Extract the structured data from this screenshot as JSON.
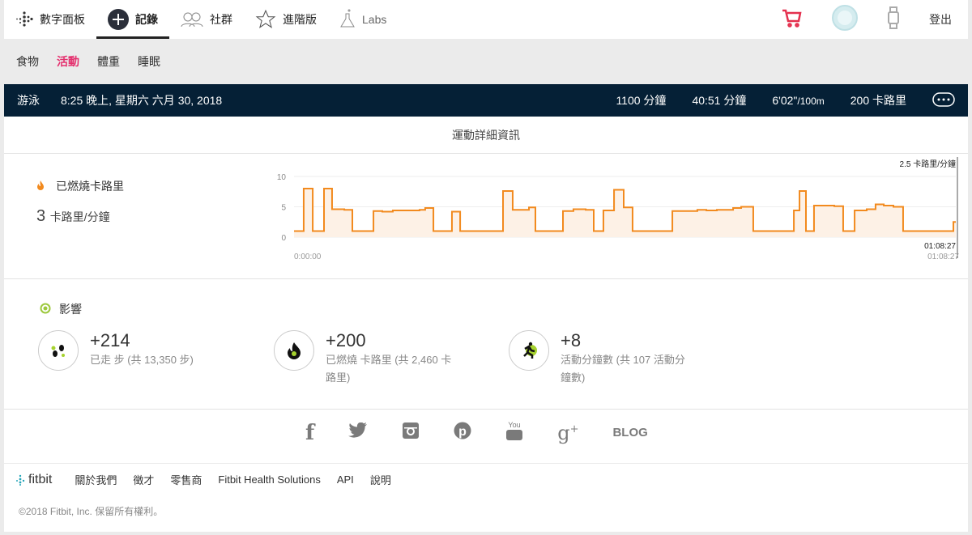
{
  "nav": {
    "items": [
      {
        "label": "數字面板",
        "icon": "fitbit-dots-icon"
      },
      {
        "label": "記錄",
        "icon": "plus-circle-icon",
        "active": true
      },
      {
        "label": "社群",
        "icon": "friends-icon"
      },
      {
        "label": "進階版",
        "icon": "star-icon"
      },
      {
        "label": "Labs",
        "icon": "flask-icon"
      }
    ],
    "logout": "登出"
  },
  "subnav": [
    "食物",
    "活動",
    "體重",
    "睡眠"
  ],
  "activity": {
    "type": "游泳",
    "datetime": "8:25 晚上, 星期六 六月 30, 2018",
    "stats": [
      "1100 分鐘",
      "40:51 分鐘"
    ],
    "pace": "6'02\"",
    "pace_unit": "/100m",
    "calories": "200 卡路里"
  },
  "detail": {
    "title": "運動詳細資訊",
    "cal_label": "已燃燒卡路里",
    "cal_value": "3",
    "cal_unit": "卡路里/分鐘"
  },
  "chart_data": {
    "type": "area",
    "ylabel": "卡路里/分鐘",
    "ylim": [
      0,
      10
    ],
    "yticks": [
      "0",
      "5",
      "10"
    ],
    "x_start_label": "0:00:00",
    "x_end_label": "01:08:27",
    "hover_value": "2.5 卡路里/分鐘",
    "hover_time": "01:08:27",
    "duration_s": 4107,
    "steps": [
      [
        0,
        1
      ],
      [
        60,
        8
      ],
      [
        116,
        1
      ],
      [
        186,
        8
      ],
      [
        236,
        4.6
      ],
      [
        312,
        4.5
      ],
      [
        362,
        1
      ],
      [
        493,
        4.3
      ],
      [
        548,
        4.2
      ],
      [
        613,
        4.4
      ],
      [
        779,
        4.5
      ],
      [
        814,
        4.8
      ],
      [
        865,
        1
      ],
      [
        980,
        4.2
      ],
      [
        1031,
        1
      ],
      [
        1297,
        7.6
      ],
      [
        1357,
        4.5
      ],
      [
        1458,
        4.9
      ],
      [
        1498,
        1
      ],
      [
        1669,
        4.3
      ],
      [
        1734,
        4.6
      ],
      [
        1810,
        4.5
      ],
      [
        1860,
        1
      ],
      [
        1920,
        4.4
      ],
      [
        1986,
        7.8
      ],
      [
        2046,
        4.9
      ],
      [
        2101,
        1
      ],
      [
        2348,
        4.3
      ],
      [
        2503,
        4.5
      ],
      [
        2559,
        4.4
      ],
      [
        2624,
        4.5
      ],
      [
        2725,
        4.8
      ],
      [
        2775,
        5.0
      ],
      [
        2850,
        1
      ],
      [
        3102,
        4.4
      ],
      [
        3137,
        7.6
      ],
      [
        3177,
        1
      ],
      [
        3227,
        5.2
      ],
      [
        3353,
        5.1
      ],
      [
        3408,
        1
      ],
      [
        3479,
        4.4
      ],
      [
        3554,
        4.6
      ],
      [
        3609,
        5.4
      ],
      [
        3660,
        5.2
      ],
      [
        3720,
        5.0
      ],
      [
        3780,
        1
      ],
      [
        4092,
        2.5
      ]
    ],
    "color": "#f28a1e"
  },
  "impact": {
    "title": "影響",
    "items": [
      {
        "value": "+214",
        "desc": "已走 步 (共 13,350 步)",
        "icon": "footsteps-icon"
      },
      {
        "value": "+200",
        "desc": "已燃燒 卡路里 (共 2,460 卡路里)",
        "icon": "flame-icon"
      },
      {
        "value": "+8",
        "desc": "活動分鐘數 (共 107 活動分鐘數)",
        "icon": "runner-icon"
      }
    ]
  },
  "social": {
    "blog": "BLOG"
  },
  "footer": {
    "brand": "fitbit",
    "links": [
      "關於我們",
      "徵才",
      "零售商",
      "Fitbit Health Solutions",
      "API",
      "說明"
    ],
    "copyright": "©2018 Fitbit, Inc. 保留所有權利。"
  }
}
